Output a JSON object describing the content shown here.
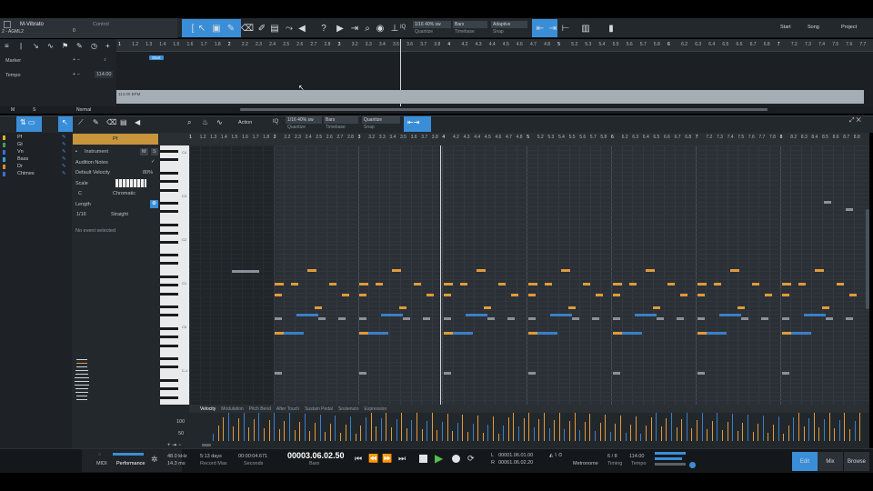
{
  "header": {
    "track_title": "M-Vibrato",
    "control_label": "Control",
    "track_sub": "2 - AGML2",
    "sub_value": "0",
    "quantize": {
      "value": "1/16 40% sw",
      "label": "Quantize"
    },
    "timebase": {
      "value": "Bars",
      "label": "Timebase"
    },
    "snap": {
      "value": "Adaptive",
      "label": "Snap"
    },
    "nav": [
      "Start",
      "Song",
      "Project"
    ]
  },
  "arrange": {
    "rows": [
      "Marker",
      "Tempo"
    ],
    "tempo_value": "114.00",
    "tempo_lane_label": "114.00 BPM",
    "marker_tag": "Start",
    "normal_label": "Normal",
    "ruler_ticks": [
      "1",
      "1.2",
      "1.3",
      "1.4",
      "1.5",
      "1.6",
      "1.7",
      "1.8",
      "2",
      "2.2",
      "2.3",
      "2.4",
      "2.5",
      "2.6",
      "2.7",
      "2.8",
      "3",
      "3.2",
      "3.3",
      "3.4",
      "3.5",
      "3.6",
      "3.7",
      "3.8",
      "4",
      "4.2",
      "4.3",
      "4.4",
      "4.5",
      "4.6",
      "4.7",
      "4.8",
      "5",
      "5.2",
      "5.3",
      "5.4",
      "5.5",
      "5.6",
      "5.7",
      "5.8",
      "6",
      "6.2",
      "6.3",
      "6.4",
      "6.5",
      "6.6",
      "6.7",
      "6.8",
      "7",
      "7.2",
      "7.3",
      "7.4",
      "7.5",
      "7.6",
      "7.7"
    ]
  },
  "editor": {
    "action_label": "Action",
    "quantize": {
      "value": "1/16 40% sw",
      "label": "Quantize"
    },
    "timebase": {
      "value": "Bars",
      "label": "Timebase"
    },
    "snap": {
      "value": "Quantize",
      "label": "Snap"
    },
    "tracks": [
      {
        "name": "Pf",
        "color": "#e0b030"
      },
      {
        "name": "Gt",
        "color": "#4a9a4a"
      },
      {
        "name": "Vn",
        "color": "#3a6fd0"
      },
      {
        "name": "Bass",
        "color": "#3aa0d8"
      },
      {
        "name": "Dr",
        "color": "#d88a30"
      },
      {
        "name": "Chimes",
        "color": "#3a6fd0"
      }
    ],
    "inspector": {
      "track": "Pf",
      "instrument_label": "Instrument",
      "m": "M",
      "s": "S",
      "audition": "Audition Notes",
      "default_velocity_label": "Default Velocity",
      "default_velocity": "80%",
      "scale_label": "Scale",
      "scale_root": "C",
      "scale_type": "Chromatic",
      "length_label": "Length",
      "length_value": "1/16",
      "length_mode": "Straight",
      "status": "No event selected"
    },
    "ruler_ticks": [
      "1",
      "1.2",
      "1.3",
      "1.4",
      "1.5",
      "1.6",
      "1.7",
      "1.8",
      "2",
      "2.2",
      "2.3",
      "2.4",
      "2.5",
      "2.6",
      "2.7",
      "2.8",
      "3",
      "3.2",
      "3.3",
      "3.4",
      "3.5",
      "3.6",
      "3.7",
      "3.8",
      "4",
      "4.2",
      "4.3",
      "4.4",
      "4.5",
      "4.6",
      "4.7",
      "4.8",
      "5",
      "5.2",
      "5.3",
      "5.4",
      "5.5",
      "5.6",
      "5.7",
      "5.8",
      "6",
      "6.2",
      "6.3",
      "6.4",
      "6.5",
      "6.6",
      "6.7",
      "6.8",
      "7",
      "7.2",
      "7.3",
      "7.4",
      "7.5",
      "7.6",
      "7.7",
      "7.8",
      "8",
      "8.2",
      "8.3",
      "8.4",
      "8.5",
      "8.6",
      "8.7",
      "8.8"
    ],
    "octaves": [
      "C4",
      "C3",
      "C2",
      "C1",
      "C0",
      "C-1"
    ],
    "vel_tabs": [
      "Velocity",
      "Modulation",
      "Pitch Bend",
      "After Touch",
      "Sustain Pedal",
      "Sostenuto",
      "Expression"
    ],
    "vel_scale": [
      "100",
      "50"
    ]
  },
  "transport": {
    "midi": "MIDI",
    "performance": "Performance",
    "sample_rate": "48.0 kHz",
    "latency": "14.3 ms",
    "record_days": "5:13 days",
    "record_label": "Record Max",
    "seconds": "00:00:04.671",
    "seconds_label": "Seconds",
    "bars": "00003.06.02.50",
    "bars_label": "Bars",
    "loop_l": "00001.06.01.00",
    "loop_r": "00061.06.02.20",
    "timing": "6 / 8",
    "timing_label": "Timing",
    "tempo": "114.00",
    "tempo_label": "Tempo",
    "metronome_label": "Metronome",
    "L": "L",
    "R": "R"
  },
  "right_tabs": [
    "Edit",
    "Mix",
    "Browse"
  ],
  "colors": {
    "accent": "#3a8ed8",
    "note_orange": "#e09a3c",
    "note_blue": "#3a7fc8"
  }
}
